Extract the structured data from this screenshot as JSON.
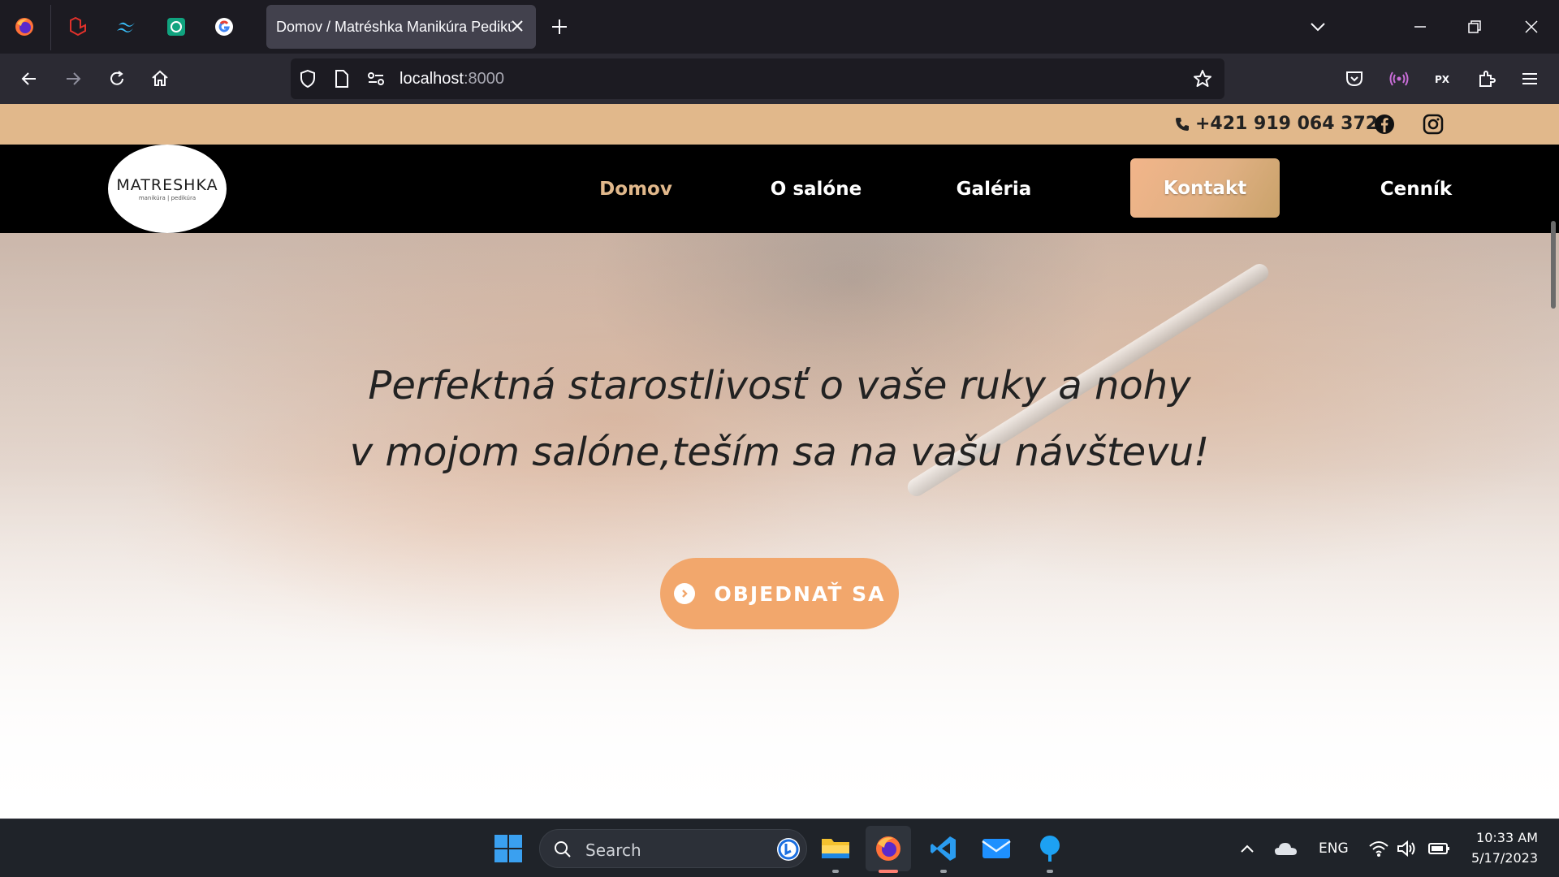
{
  "browser": {
    "tab_title": "Domov / Matréshka Manikúra Pedikúra",
    "url_host": "localhost",
    "url_port": ":8000"
  },
  "site": {
    "phone": "+421 919 064 372",
    "logo": {
      "name": "MATRESHKA",
      "tagline": "manikúra | pedikúra"
    },
    "nav": [
      {
        "label": "Domov"
      },
      {
        "label": "O salóne"
      },
      {
        "label": "Galéria"
      },
      {
        "label": "Kontakt"
      },
      {
        "label": "Cenník"
      }
    ],
    "hero": {
      "line1": "Perfektná starostlivosť o vaše ruky a nohy",
      "line2": "v mojom salóne,teším sa na vašu návštevu!",
      "button": "OBJEDNAŤ SA"
    }
  },
  "taskbar": {
    "search_label": "Search",
    "language": "ENG",
    "time": "10:33 AM",
    "date": "5/17/2023"
  },
  "colors": {
    "topbar": "#e1b88b",
    "nav_active": "#e1b88b",
    "cta": "#f2a76c"
  }
}
